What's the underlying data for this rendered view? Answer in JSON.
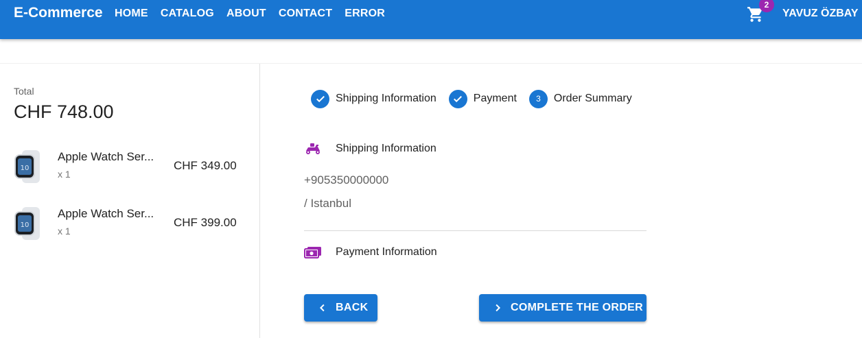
{
  "header": {
    "brand": "E-Commerce",
    "nav": [
      "HOME",
      "CATALOG",
      "ABOUT",
      "CONTACT",
      "ERROR"
    ],
    "cart_count": "2",
    "user": "YAVUZ ÖZBAY"
  },
  "summary": {
    "total_label": "Total",
    "total_value": "CHF 748.00",
    "items": [
      {
        "name": "Apple Watch Ser...",
        "qty": "x 1",
        "price": "CHF 349.00"
      },
      {
        "name": "Apple Watch Ser...",
        "qty": "x 1",
        "price": "CHF 399.00"
      }
    ]
  },
  "stepper": {
    "steps": [
      {
        "label": "Shipping Information",
        "state": "completed"
      },
      {
        "label": "Payment",
        "state": "completed"
      },
      {
        "label": "Order Summary",
        "number": "3",
        "state": "active"
      }
    ]
  },
  "review": {
    "shipping_title": "Shipping Information",
    "shipping_lines": [
      "+905350000000",
      "/ Istanbul"
    ],
    "payment_title": "Payment Information"
  },
  "actions": {
    "back_label": "BACK",
    "complete_label": "COMPLETE THE ORDER"
  },
  "colors": {
    "primary": "#1976d2",
    "secondary": "#9c27b0"
  }
}
